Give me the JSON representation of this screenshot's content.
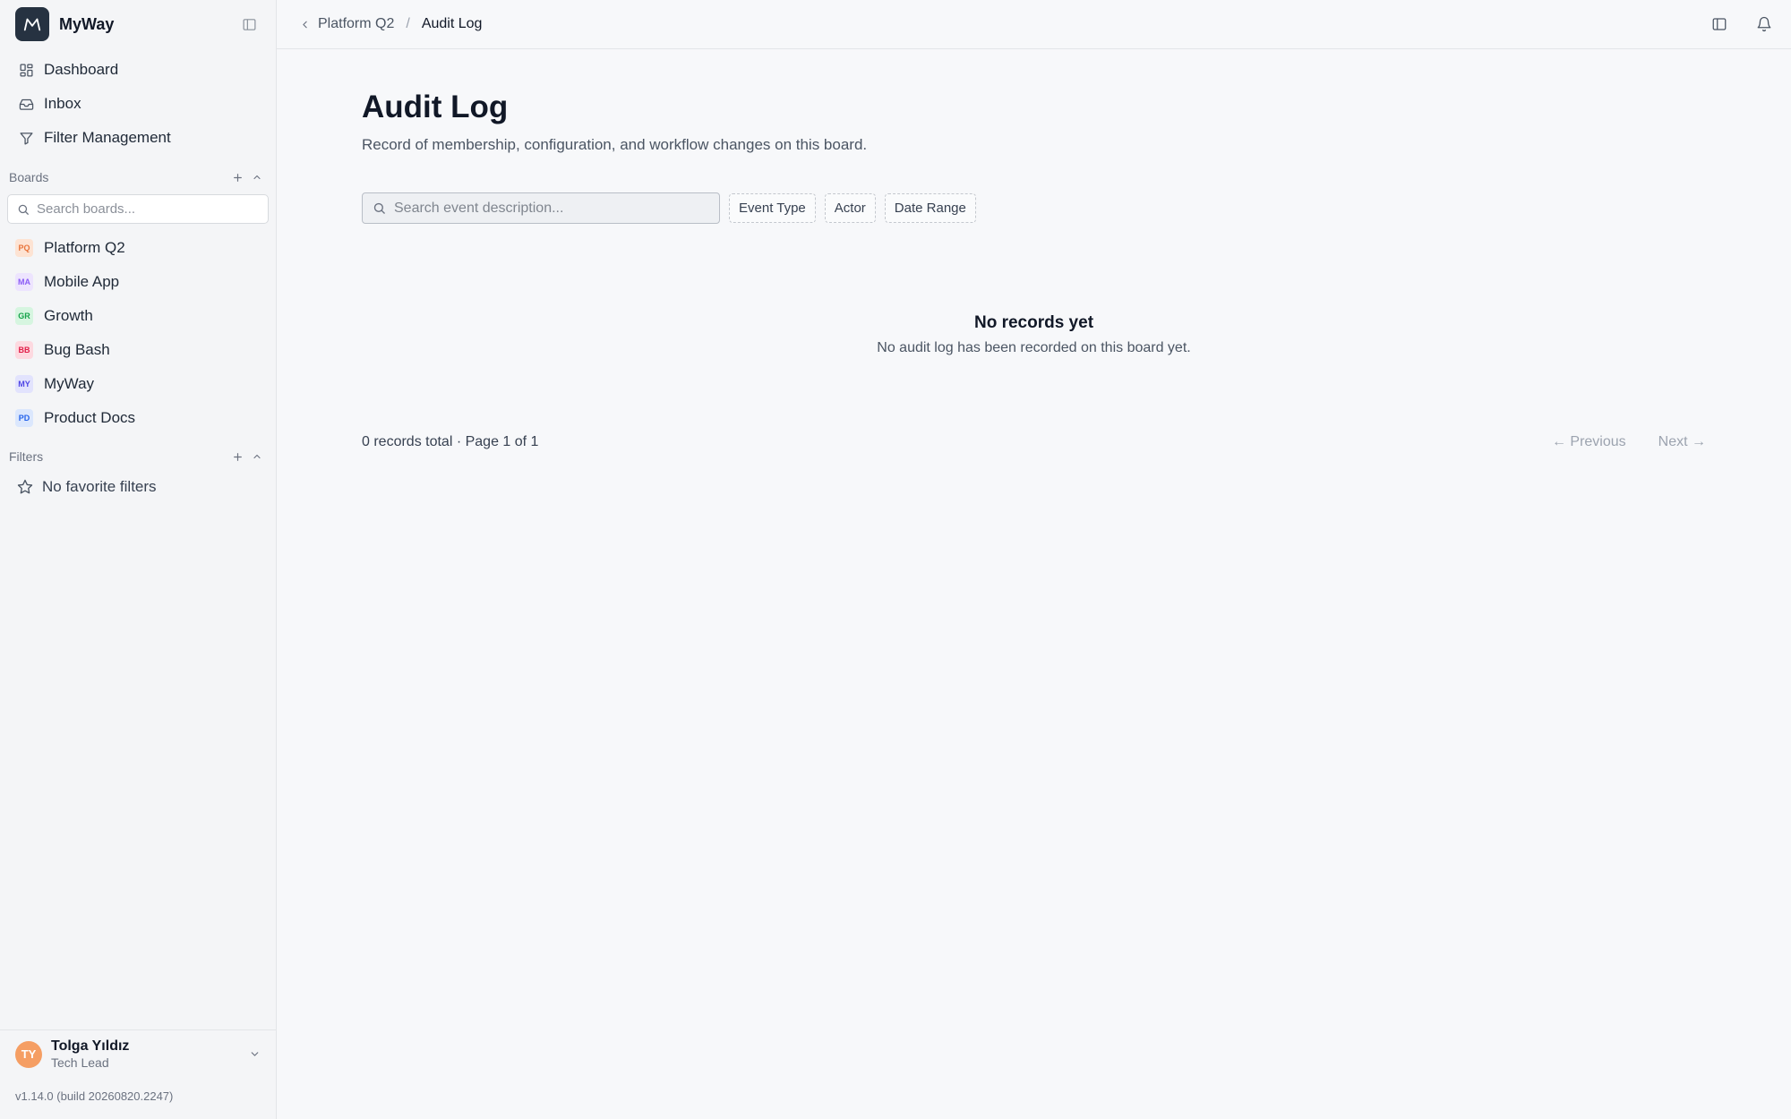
{
  "brand": {
    "name": "MyWay"
  },
  "nav": [
    {
      "label": "Dashboard",
      "icon": "grid-icon"
    },
    {
      "label": "Inbox",
      "icon": "inbox-icon"
    },
    {
      "label": "Filter Management",
      "icon": "filter-icon"
    }
  ],
  "boards": {
    "label": "Boards",
    "search_placeholder": "Search boards...",
    "items": [
      {
        "label": "Platform Q2",
        "abbr": "PQ",
        "color": "#e8743b",
        "bg": "#fde3d3"
      },
      {
        "label": "Mobile App",
        "abbr": "MA",
        "color": "#8b5cf6",
        "bg": "#ede4fe"
      },
      {
        "label": "Growth",
        "abbr": "GR",
        "color": "#16a34a",
        "bg": "#d6f5e0"
      },
      {
        "label": "Bug Bash",
        "abbr": "BB",
        "color": "#e11d48",
        "bg": "#fdd9e0"
      },
      {
        "label": "MyWay",
        "abbr": "MY",
        "color": "#4f46e5",
        "bg": "#e2e3fd"
      },
      {
        "label": "Product Docs",
        "abbr": "PD",
        "color": "#2563eb",
        "bg": "#dbe7fd"
      }
    ]
  },
  "filters": {
    "label": "Filters",
    "empty": "No favorite filters"
  },
  "user": {
    "initials": "TY",
    "name": "Tolga Yıldız",
    "role": "Tech Lead"
  },
  "version": "v1.14.0 (build 20260820.2247)",
  "breadcrumb": {
    "parent": "Platform Q2",
    "separator": "/",
    "current": "Audit Log"
  },
  "page": {
    "title": "Audit Log",
    "subtitle": "Record of membership, configuration, and workflow changes on this board."
  },
  "toolbar": {
    "search_placeholder": "Search event description...",
    "chips": [
      "Event Type",
      "Actor",
      "Date Range"
    ]
  },
  "empty": {
    "title": "No records yet",
    "description": "No audit log has been recorded on this board yet."
  },
  "pagination": {
    "info": "0 records total · Page 1 of 1",
    "previous": "← Previous",
    "next": "Next →"
  }
}
